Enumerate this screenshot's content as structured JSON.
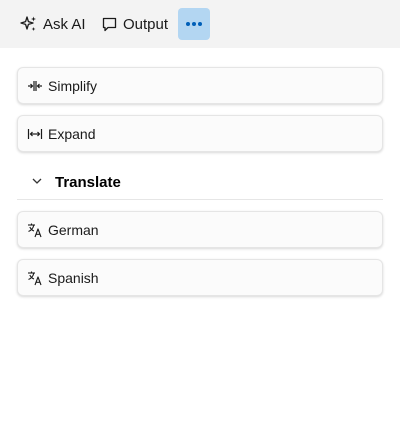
{
  "toolbar": {
    "ask_ai_label": "Ask AI",
    "output_label": "Output",
    "more_icon": "more-horizontal-icon"
  },
  "actions": {
    "simplify_label": "Simplify",
    "expand_label": "Expand"
  },
  "translate": {
    "section_title": "Translate",
    "expanded": true,
    "german_label": "German",
    "spanish_label": "Spanish"
  },
  "colors": {
    "toolbar_background": "#f3f3f3",
    "selected_button_background": "#b3d6f2",
    "accent": "#005fb8",
    "card_background": "#fbfbfb"
  }
}
